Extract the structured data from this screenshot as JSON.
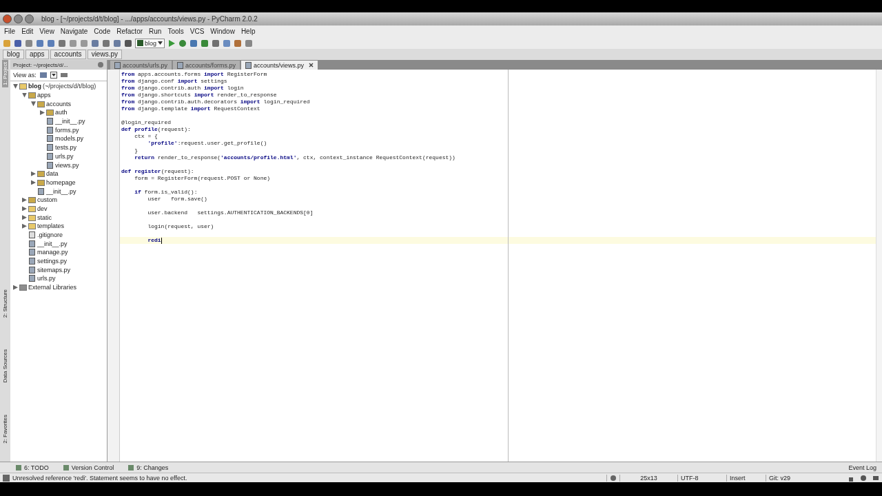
{
  "window": {
    "title": "blog - [~/projects/d/t/blog] - .../apps/accounts/views.py - PyCharm 2.0.2"
  },
  "menu": [
    "File",
    "Edit",
    "View",
    "Navigate",
    "Code",
    "Refactor",
    "Run",
    "Tools",
    "VCS",
    "Window",
    "Help"
  ],
  "toolbar": {
    "run_config": "blog"
  },
  "breadcrumbs": [
    "blog",
    "apps",
    "accounts",
    "views.py"
  ],
  "side_tabs": [
    {
      "label": "1: Project",
      "selected": true
    },
    {
      "label": "2: Structure",
      "selected": false
    },
    {
      "label": "Data Sources",
      "selected": false
    },
    {
      "label": "2: Favorites",
      "selected": false
    }
  ],
  "project_panel": {
    "title": "Project: ~/projects/d/...",
    "view_as": "View as:",
    "tree": [
      {
        "name": "blog",
        "path": "(~/projects/d/t/blog)",
        "kind": "folder",
        "expanded": true,
        "children": [
          {
            "name": "apps",
            "kind": "package",
            "expanded": true,
            "children": [
              {
                "name": "accounts",
                "kind": "package",
                "expanded": true,
                "children": [
                  {
                    "name": "auth",
                    "kind": "package",
                    "expanded": false
                  },
                  {
                    "name": "__init__.py",
                    "kind": "file"
                  },
                  {
                    "name": "forms.py",
                    "kind": "file"
                  },
                  {
                    "name": "models.py",
                    "kind": "file"
                  },
                  {
                    "name": "tests.py",
                    "kind": "file"
                  },
                  {
                    "name": "urls.py",
                    "kind": "file"
                  },
                  {
                    "name": "views.py",
                    "kind": "file"
                  }
                ]
              },
              {
                "name": "data",
                "kind": "package",
                "expanded": false
              },
              {
                "name": "homepage",
                "kind": "package",
                "expanded": false
              },
              {
                "name": "__init__.py",
                "kind": "file"
              }
            ]
          },
          {
            "name": "custom",
            "kind": "package",
            "expanded": false
          },
          {
            "name": "dev",
            "kind": "folder",
            "expanded": false
          },
          {
            "name": "static",
            "kind": "folder",
            "expanded": false
          },
          {
            "name": "templates",
            "kind": "folder",
            "expanded": false
          },
          {
            "name": ".gitignore",
            "kind": "text"
          },
          {
            "name": "__init__.py",
            "kind": "file"
          },
          {
            "name": "manage.py",
            "kind": "file"
          },
          {
            "name": "settings.py",
            "kind": "file"
          },
          {
            "name": "sitemaps.py",
            "kind": "file"
          },
          {
            "name": "urls.py",
            "kind": "file"
          }
        ]
      },
      {
        "name": "External Libraries",
        "kind": "library",
        "expanded": false
      }
    ]
  },
  "editor_tabs": [
    {
      "label": "accounts/urls.py",
      "selected": false
    },
    {
      "label": "accounts/forms.py",
      "selected": false
    },
    {
      "label": "accounts/views.py",
      "selected": true
    }
  ],
  "code": [
    {
      "kind": "code",
      "text": "**from** apps.accounts.forms **import** RegisterForm"
    },
    {
      "kind": "code",
      "text": "**from** django.conf **import** settings"
    },
    {
      "kind": "code",
      "text": "**from** django.contrib.auth **import** login"
    },
    {
      "kind": "code",
      "text": "**from** django.shortcuts **import** render_to_response"
    },
    {
      "kind": "code",
      "text": "**from** django.contrib.auth.decorators **import** login_required"
    },
    {
      "kind": "code",
      "text": "**from** django.template **import** RequestContext"
    },
    {
      "kind": "blank"
    },
    {
      "kind": "code",
      "text": "@login_required"
    },
    {
      "kind": "code",
      "text": "**def** **profile**(request):"
    },
    {
      "kind": "code",
      "text": "    ctx = {"
    },
    {
      "kind": "code",
      "text": "        **'profile'**:request.user.get_profile()"
    },
    {
      "kind": "code",
      "text": "    }"
    },
    {
      "kind": "code",
      "text": "    **return** render_to_response(**'accounts/profile.html'**, ctx, context_instance RequestContext(request))"
    },
    {
      "kind": "blank"
    },
    {
      "kind": "code",
      "text": "**def** **register**(request):"
    },
    {
      "kind": "code",
      "text": "    form = RegisterForm(request.POST or None)"
    },
    {
      "kind": "blank"
    },
    {
      "kind": "code",
      "text": "    **if** form.is_valid():"
    },
    {
      "kind": "code",
      "text": "        user   form.save()"
    },
    {
      "kind": "blank"
    },
    {
      "kind": "code",
      "text": "        user.backend   settings.AUTHENTICATION_BACKENDS[0]"
    },
    {
      "kind": "blank"
    },
    {
      "kind": "code",
      "text": "        login(request, user)"
    },
    {
      "kind": "blank"
    },
    {
      "kind": "current",
      "text": "        **redi**"
    }
  ],
  "tool_tabs": [
    "6: TODO",
    "Version Control",
    "9: Changes"
  ],
  "event_log": "Event Log",
  "status_bar": {
    "message": "Unresolved reference 'redi'. Statement seems to have no effect.",
    "position": "25x13",
    "encoding": "UTF-8",
    "mode": "Insert",
    "vcs": "Git: v29"
  }
}
